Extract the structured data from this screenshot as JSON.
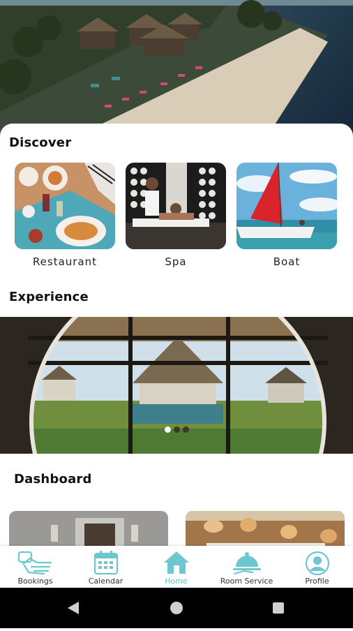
{
  "hero": {
    "image": "resort-beach-aerial"
  },
  "discover": {
    "title": "Discover",
    "cards": [
      {
        "label": "Restaurant",
        "image": "restaurant-table"
      },
      {
        "label": "Spa",
        "image": "spa-massage"
      },
      {
        "label": "Boat",
        "image": "red-sail-boat"
      }
    ]
  },
  "experience": {
    "title": "Experience",
    "image": "round-window-pool-view",
    "carousel": {
      "count": 3,
      "active_index": 0
    }
  },
  "dashboard": {
    "title": "Dashboard",
    "cards": [
      {
        "image": "room-interior"
      },
      {
        "image": "lamp-lounge"
      }
    ]
  },
  "tabbar": {
    "active_color": "#5fc3c8",
    "tabs": [
      {
        "label": "Bookings",
        "icon": "bookings-icon"
      },
      {
        "label": "Calendar",
        "icon": "calendar-icon"
      },
      {
        "label": "Home",
        "icon": "home-icon",
        "active": true
      },
      {
        "label": "Room Service",
        "icon": "room-service-icon"
      },
      {
        "label": "Profile",
        "icon": "profile-icon"
      }
    ]
  },
  "system_nav": {
    "buttons": [
      "back",
      "home",
      "recents"
    ]
  }
}
